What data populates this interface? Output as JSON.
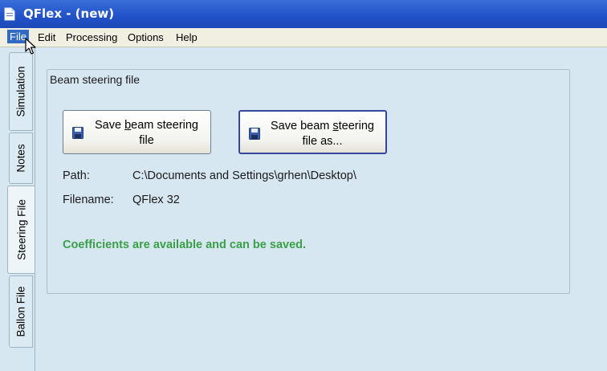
{
  "window": {
    "title": "QFlex - (new)"
  },
  "menu": [
    {
      "label": "File",
      "active": true
    },
    {
      "label": "Edit"
    },
    {
      "label": "Processing"
    },
    {
      "label": "Options"
    },
    {
      "label": "Help"
    }
  ],
  "tabs": [
    {
      "label": "Simulation"
    },
    {
      "label": "Notes"
    },
    {
      "label": "Steering File",
      "selected": true
    },
    {
      "label": "Ballon File"
    }
  ],
  "panel": {
    "group_title": "Beam steering file",
    "save_button": {
      "line1_pre": "Save ",
      "line1_u": "b",
      "line1_post": "eam steering",
      "line2": "file"
    },
    "save_as_button": {
      "line1_pre": "Save beam ",
      "line1_u": "s",
      "line1_post": "teering",
      "line2": "file as..."
    },
    "path_label": "Path:",
    "path_value": "C:\\Documents and Settings\\grhen\\Desktop\\",
    "filename_label": "Filename:",
    "filename_value": "QFlex 32",
    "status": "Coefficients are available and can be saved."
  },
  "colors": {
    "titlebar": "#2253c9",
    "menu_highlight": "#316ac5",
    "panel_bg": "#d7e7f1",
    "status_text": "#3aa048"
  },
  "icons": [
    "app-document-icon",
    "mouse-pointer-icon",
    "floppy-disk-icon"
  ]
}
